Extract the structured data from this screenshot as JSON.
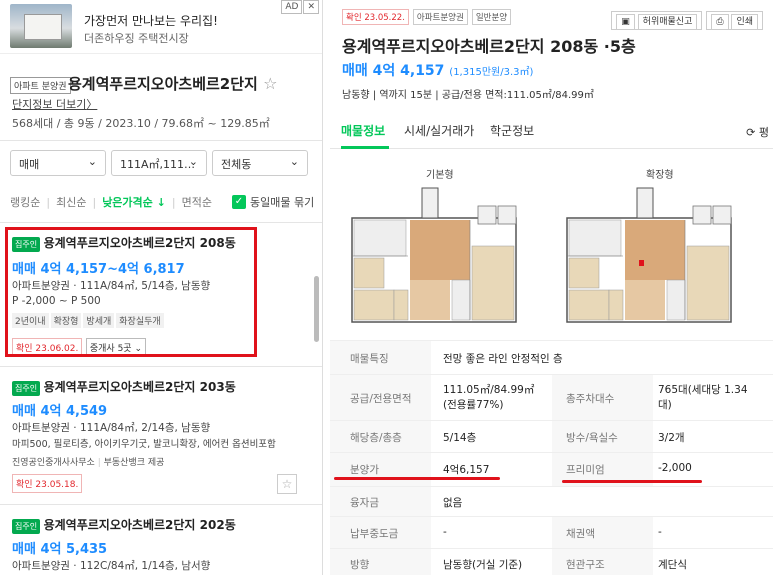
{
  "ad": {
    "title": "가장먼저 만나보는 우리집!",
    "subtitle": "더존하우징 주택전시장",
    "badge": "AD",
    "close": "✕"
  },
  "complex": {
    "type_tag": "아파트 분양권",
    "name": "용계역푸르지오아츠베르2단지",
    "more_link": "단지정보 더보기",
    "meta": "568세대 / 총 9동 / 2023.10 / 79.68㎡ ~ 129.85㎡"
  },
  "filters": {
    "trade": "매매",
    "area": "111A㎡,111…",
    "building": "전체동"
  },
  "sort": {
    "options": [
      "랭킹순",
      "최신순",
      "낮은가격순",
      "면적순"
    ],
    "active_arrow": "↓",
    "same_listing": "동일매물 묶기"
  },
  "listings": [
    {
      "owner_tag": "집주인",
      "title": "용계역푸르지오아츠베르2단지 208동",
      "price": "매매 4억 4,157~4억 6,817",
      "info": "아파트분양권 · 111A/84㎡, 5/14층, 남동향",
      "premium": "P -2,000 ~ P 500",
      "features": [
        "2년이내",
        "확장형",
        "방세개",
        "화장실두개"
      ],
      "confirm": "확인 23.06.02.",
      "agents": "중개사 5곳"
    },
    {
      "owner_tag": "집주인",
      "title": "용계역푸르지오아츠베르2단지 203동",
      "price": "매매 4억 4,549",
      "info": "아파트분양권 · 111A/84㎡, 2/14층, 남동향",
      "desc": "마피500, 필로티층, 아이키우기굿, 발코니확장, 에어컨 옵션비포함",
      "agency": "진영공인중개사사무소",
      "provider": "부동산뱅크 제공",
      "confirm": "확인 23.05.18."
    },
    {
      "owner_tag": "집주인",
      "title": "용계역푸르지오아츠베르2단지 202동",
      "price": "매매 4억 5,435",
      "info": "아파트분양권 · 112C/84㎡, 1/14층, 남서향"
    }
  ],
  "detail": {
    "tags": [
      "확인 23.05.22.",
      "아파트분양권",
      "일반분양"
    ],
    "report_btn": "허위매물신고",
    "print_btn": "인쇄",
    "title": "용계역푸르지오아츠베르2단지 208동 ·5층",
    "price": "매매 4억 4,157",
    "price_unit": "(1,315만원/3.3㎡)",
    "summary": "남동향  |  역까지 15분  |  공급/전용 면적:111.05㎡/84.99㎡",
    "tabs": [
      "매물정보",
      "시세/실거래가",
      "학군정보"
    ],
    "refresh": "⟳ 평",
    "plans": [
      "기본형",
      "확장형"
    ],
    "rows": [
      {
        "label": "매물특징",
        "value": "전망 좋은 라인 안정적인 층"
      },
      {
        "label": "공급/전용면적",
        "value": "111.05㎡/84.99㎡(전용률77%)",
        "label2": "총주차대수",
        "value2": "765대(세대당 1.34대)"
      },
      {
        "label": "해당층/총층",
        "value": "5/14층",
        "label2": "방수/욕실수",
        "value2": "3/2개"
      },
      {
        "label": "분양가",
        "value": "4억6,157",
        "label2": "프리미엄",
        "value2": "-2,000"
      },
      {
        "label": "융자금",
        "value": "없음"
      },
      {
        "label": "납부중도금",
        "value": "-",
        "label2": "채권액",
        "value2": "-"
      },
      {
        "label": "방향",
        "value": "남동향(거실 기준)",
        "label2": "현관구조",
        "value2": "계단식"
      }
    ]
  }
}
